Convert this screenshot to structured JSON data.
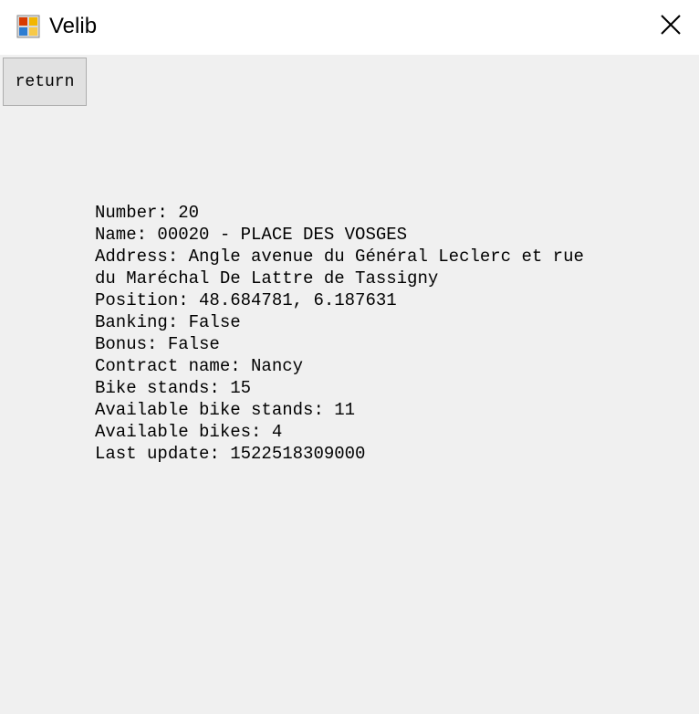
{
  "window": {
    "title": "Velib",
    "icon": "app-window-icon",
    "close_icon": "close-icon"
  },
  "toolbar": {
    "return_label": "return"
  },
  "station": {
    "number": "Number: 20",
    "name": "Name: 00020 - PLACE DES VOSGES",
    "address_line1": "Address: Angle avenue du Général Leclerc et rue",
    "address_line2": "du Maréchal De Lattre de Tassigny",
    "position": "Position: 48.684781, 6.187631",
    "banking": "Banking: False",
    "bonus": "Bonus: False",
    "contract_name": "Contract name: Nancy",
    "bike_stands": "Bike stands: 15",
    "available_bike_stands": "Available bike stands: 11",
    "available_bikes": "Available bikes: 4",
    "last_update": "Last update: 1522518309000"
  }
}
